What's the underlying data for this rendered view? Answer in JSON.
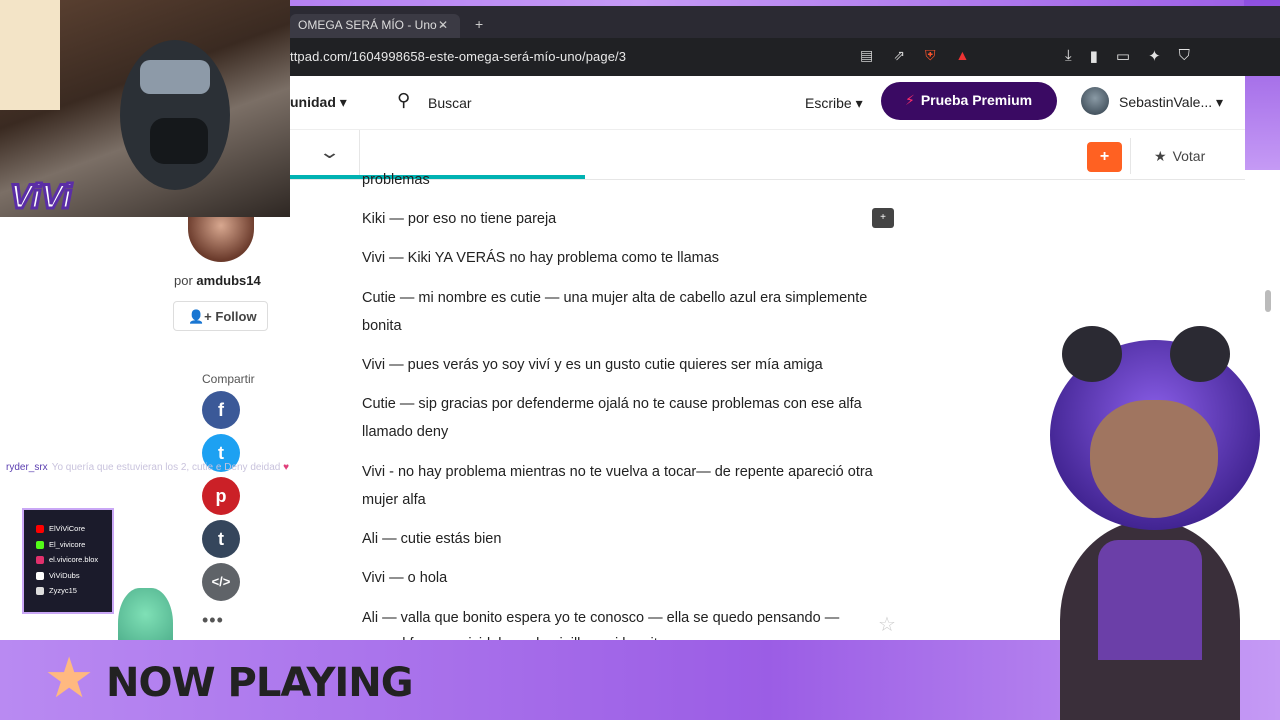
{
  "browser": {
    "tab_title": "OMEGA SERÁ MÍO - Uno -",
    "url": "ttpad.com/1604998658-este-omega-será-mío-uno/page/3"
  },
  "nav": {
    "comunidad": "unidad",
    "search_label": "Buscar",
    "escribe": "Escribe",
    "premium": "Prueba Premium",
    "username": "SebastinVale..."
  },
  "storybar": {
    "plus": "+",
    "votar": "Votar"
  },
  "author": {
    "por": "por",
    "name": "amdubs14",
    "follow": "Follow"
  },
  "share": {
    "label": "Compartir"
  },
  "story": {
    "partial_top": "problemas",
    "paragraphs": [
      "Kiki — por eso no tiene pareja",
      "Vivi — Kiki YA VERÁS no hay problema como te llamas",
      "Cutie — mi nombre es cutie — una mujer alta de cabello azul era simplemente bonita",
      "Vivi — pues verás yo soy viví y es un gusto cutie quieres ser mía amiga",
      "Cutie — sip gracias por defenderme ojalá no te cause problemas con ese alfa llamado deny",
      "Vivi - no hay problema mientras no te vuelva a tocar— de repente apareció otra mujer alfa",
      "Ali — cutie estás bien",
      "Vivi — o hola",
      "Ali — valla que bonito espera yo te conosco — ella se quedo pensando —",
      "eres el famoso vividubs — lo pinillo casi lo grito"
    ]
  },
  "chat": {
    "user": "ryder_srx",
    "message": "Yo quería que estuvieran los 2, cutie e Deny deidad"
  },
  "socials": [
    {
      "label": "ElViViCore",
      "color": "#ff0000"
    },
    {
      "label": "El_vivicore",
      "color": "#53fc18"
    },
    {
      "label": "el.vivicore.blox",
      "color": "#e1306c"
    },
    {
      "label": "ViViDubs",
      "color": "#ffffff"
    },
    {
      "label": "Zyzyc15",
      "color": "#dddddd"
    }
  ],
  "overlay": {
    "logo": "ViVi",
    "now_playing": "NOW PLAYING"
  }
}
